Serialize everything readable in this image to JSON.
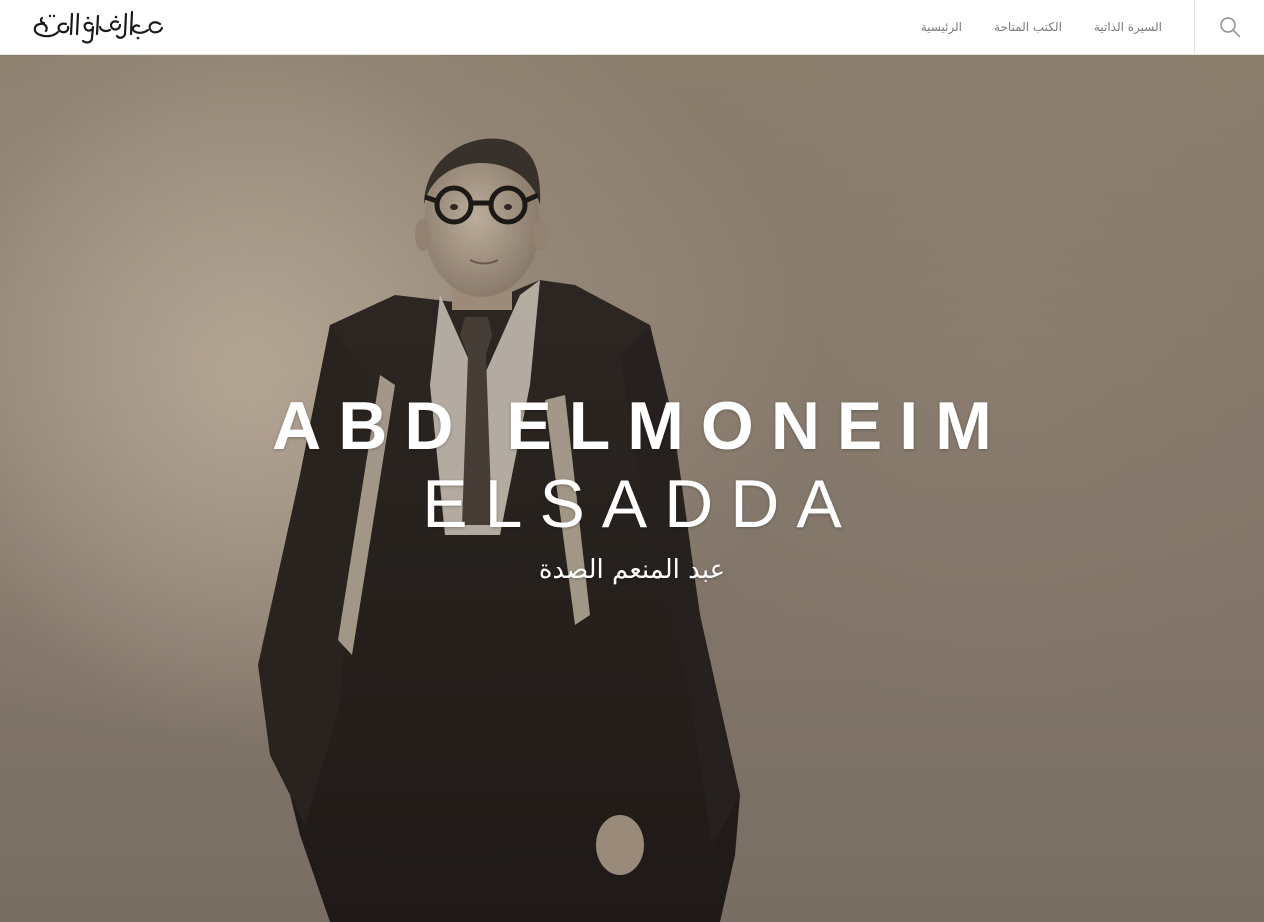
{
  "header": {
    "logo_alt": "عبدالمنعم الصدة",
    "nav": [
      {
        "label": "السيرة الذاتية"
      },
      {
        "label": "الكتب المتاحة"
      },
      {
        "label": "الرئيسية"
      }
    ],
    "search_icon": "search-icon"
  },
  "hero": {
    "title_line1": "ABD ELMONEIM",
    "title_line2": "ELSADDA",
    "subtitle": "عبد المنعم الصدة",
    "photo_description_icon": "portrait-photo"
  },
  "colors": {
    "header_bg": "#ffffff",
    "nav_text": "#7a7a7a",
    "hero_text": "#ffffff",
    "photo_tone": "#8b7f71"
  }
}
